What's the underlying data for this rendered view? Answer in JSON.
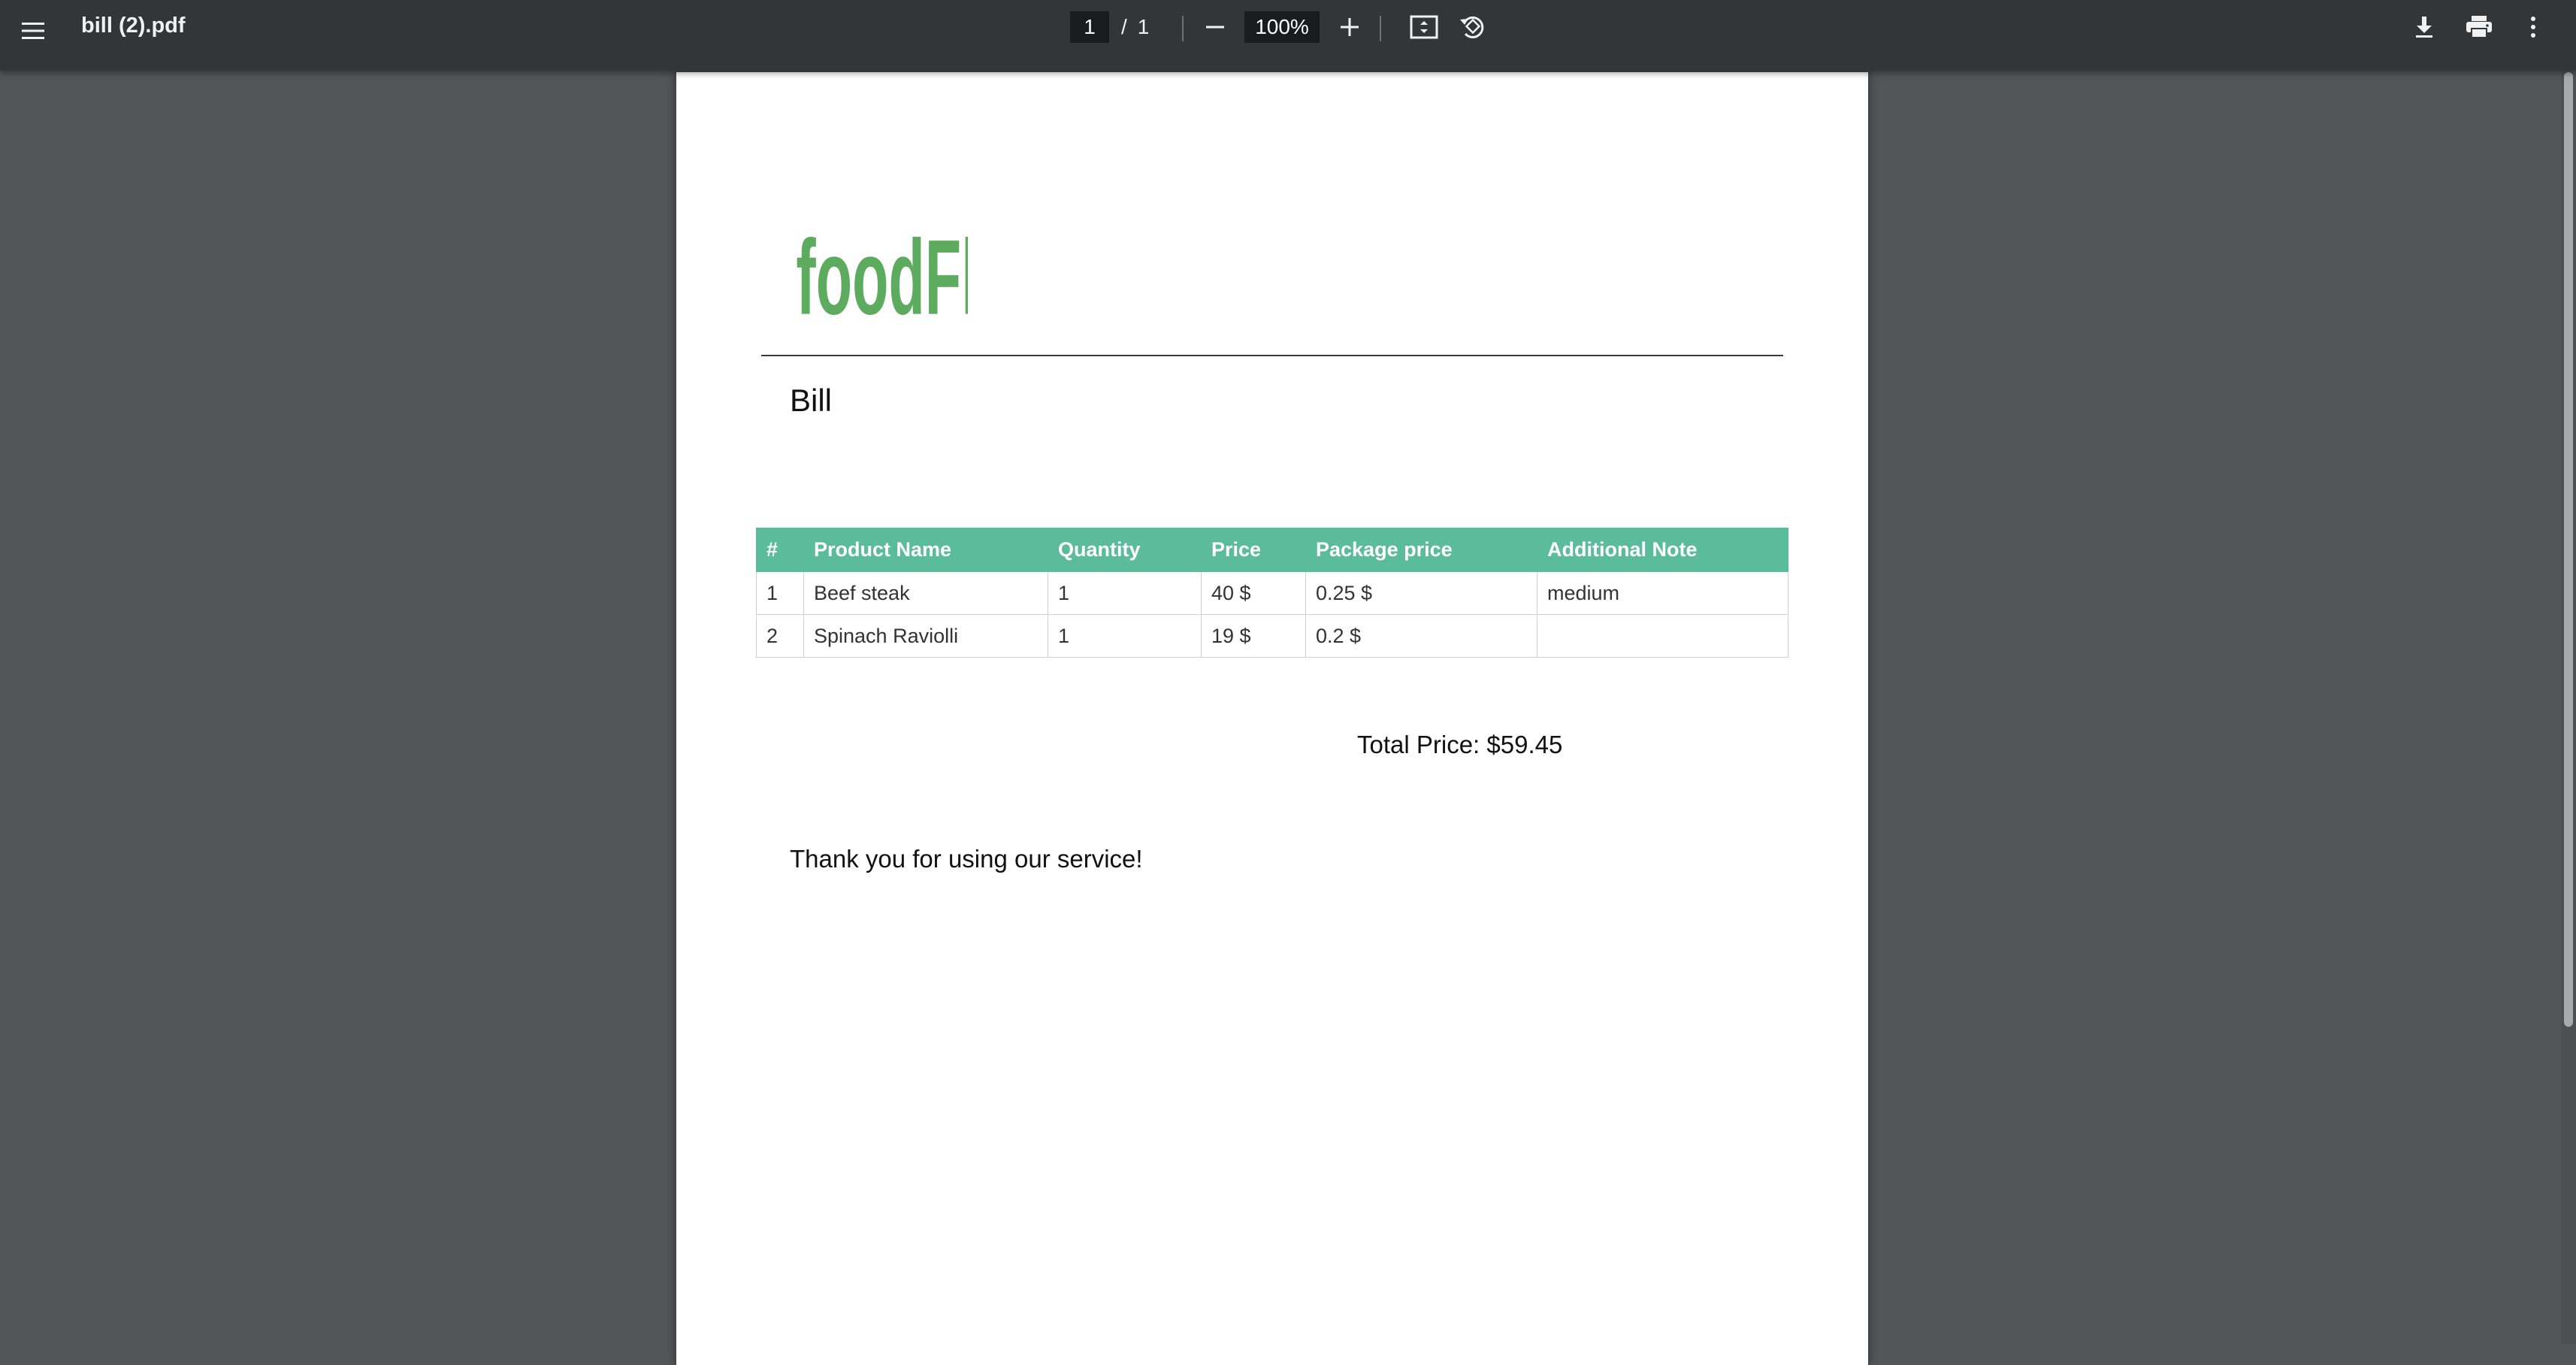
{
  "toolbar": {
    "title": "bill (2).pdf",
    "current_page": "1",
    "separator": "/",
    "total_pages": "1",
    "zoom": "100%",
    "icons": [
      "menu-icon",
      "zoom-out-icon",
      "zoom-in-icon",
      "fit-to-page-icon",
      "rotate-icon",
      "download-icon",
      "print-icon",
      "more-vert-icon"
    ]
  },
  "document": {
    "logo_text": "foodFly.",
    "logo_color": "#5cab5f",
    "heading": "Bill",
    "table": {
      "header_color": "#5bbc9c",
      "columns": [
        "#",
        "Product Name",
        "Quantity",
        "Price",
        "Package price",
        "Additional Note"
      ],
      "rows": [
        [
          "1",
          "Beef steak",
          "1",
          "40 $",
          "0.25 $",
          "medium"
        ],
        [
          "2",
          "Spinach Raviolli",
          "1",
          "19 $",
          "0.2 $",
          ""
        ]
      ]
    },
    "total_price": "Total Price: $59.45",
    "thank_you": "Thank you for using our service!"
  }
}
